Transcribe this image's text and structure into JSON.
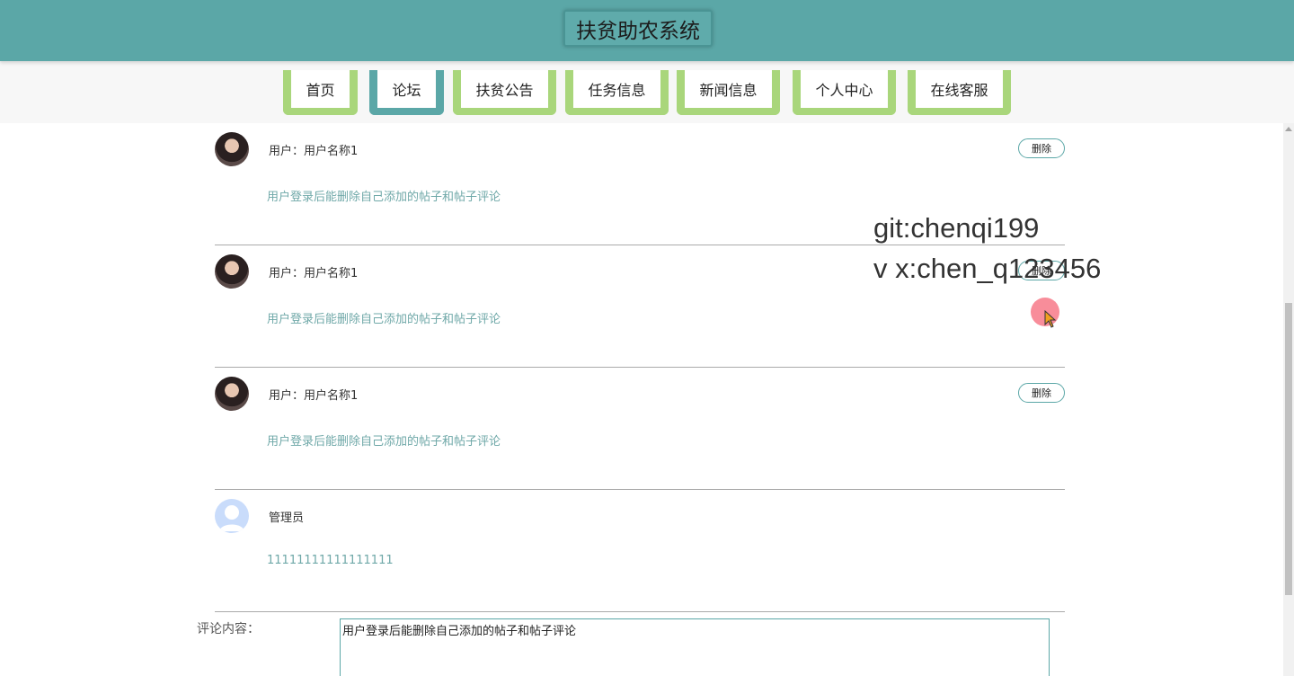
{
  "header": {
    "title": "扶贫助农系统"
  },
  "nav": {
    "items": [
      {
        "label": "首页"
      },
      {
        "label": "论坛"
      },
      {
        "label": "扶贫公告"
      },
      {
        "label": "任务信息"
      },
      {
        "label": "新闻信息"
      },
      {
        "label": "个人中心"
      },
      {
        "label": "在线客服"
      }
    ],
    "active": "论坛"
  },
  "posts": [
    {
      "user": "用户：用户名称1",
      "content": "用户登录后能删除自己添加的帖子和帖子评论",
      "delete_label": "删除",
      "avatar": "user-photo"
    },
    {
      "user": "用户：用户名称1",
      "content": "用户登录后能删除自己添加的帖子和帖子评论",
      "delete_label": "删除",
      "avatar": "user-photo"
    },
    {
      "user": "用户：用户名称1",
      "content": "用户登录后能删除自己添加的帖子和帖子评论",
      "delete_label": "删除",
      "avatar": "user-photo"
    },
    {
      "user": "管理员",
      "content": "11111111111111111",
      "avatar": "default-avatar"
    }
  ],
  "comment_form": {
    "label": "评论内容：",
    "value": "用户登录后能删除自己添加的帖子和帖子评论"
  },
  "watermark": {
    "line1": "git:chenqi199",
    "line2": "v x:chen_q123456"
  },
  "colors": {
    "primary": "#5ba7a7",
    "nav_accent": "#a9d67b",
    "content_text": "#6fa8a8"
  }
}
